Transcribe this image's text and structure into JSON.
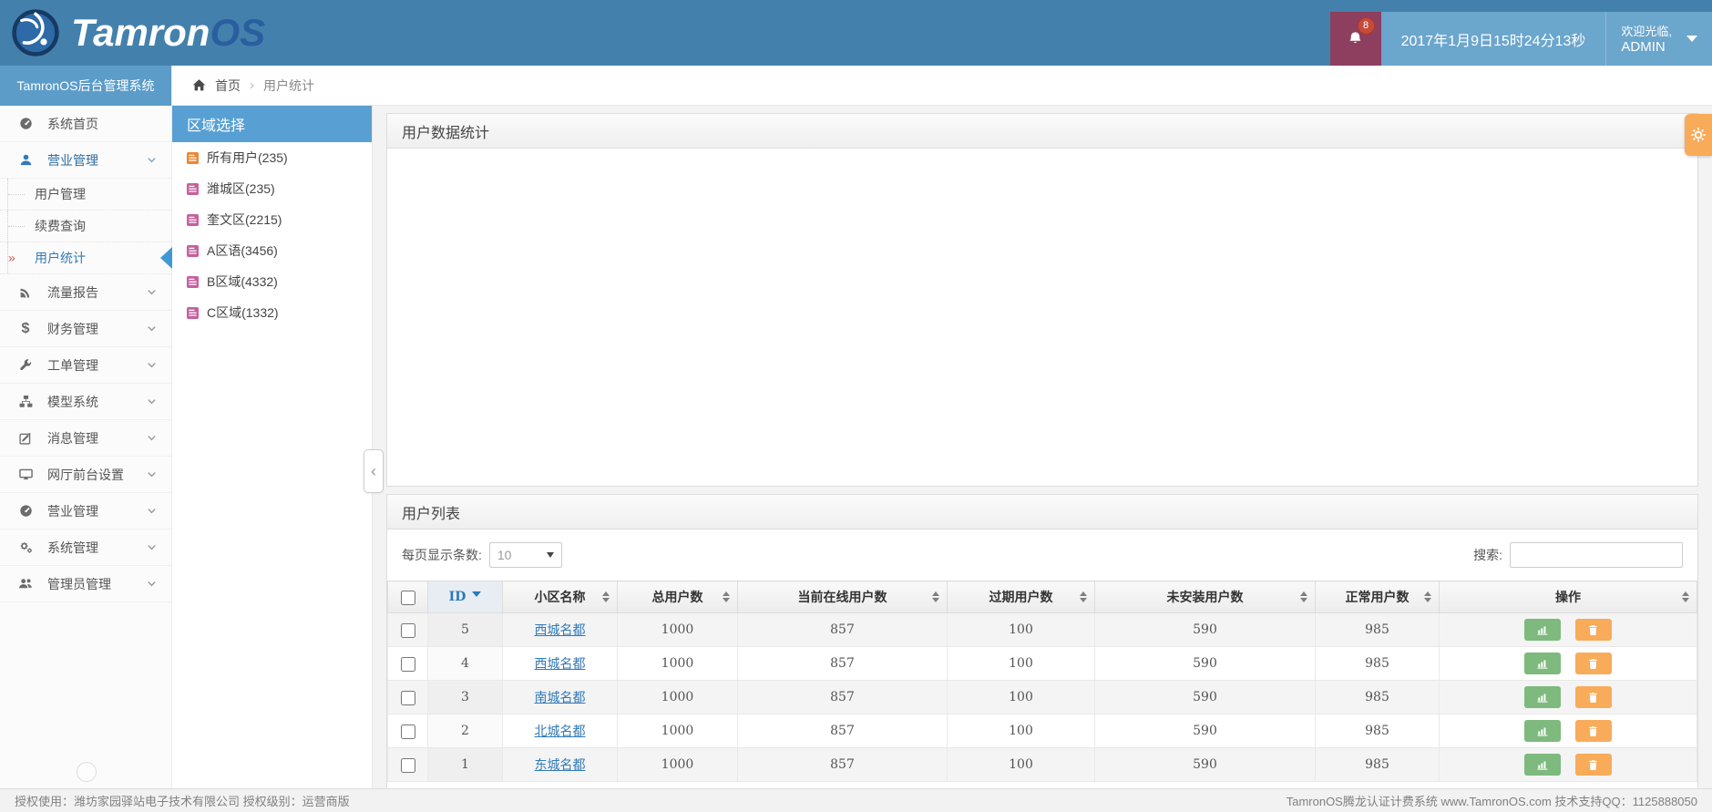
{
  "header": {
    "brand": "Tamron",
    "brand_accent": "OS",
    "badge_count": "8",
    "datetime": "2017年1月9日15时24分13秒",
    "welcome": "欢迎光临,",
    "username": "ADMIN"
  },
  "nav": {
    "title": "TamronOS后台管理系统",
    "items": [
      "系统首页",
      "营业管理",
      "流量报告",
      "财务管理",
      "工单管理",
      "模型系统",
      "消息管理",
      "网厅前台设置",
      "营业管理",
      "系统管理",
      "管理员管理"
    ],
    "sub_items": [
      "用户管理",
      "续费查询",
      "用户统计"
    ]
  },
  "breadcrumb": {
    "home": "首页",
    "separator": "›",
    "current": "用户统计"
  },
  "region": {
    "title": "区域选择",
    "items": [
      "所有用户(235)",
      "潍城区(235)",
      "奎文区(2215)",
      "A区语(3456)",
      "B区域(4332)",
      "C区域(1332)"
    ]
  },
  "stats_panel": {
    "title": "用户数据统计"
  },
  "list_panel": {
    "title": "用户列表",
    "per_page_label": "每页显示条数:",
    "per_page_value": "10",
    "search_label": "搜索:",
    "columns": [
      "ID",
      "小区名称",
      "总用户数",
      "当前在线用户数",
      "过期用户数",
      "未安装用户数",
      "正常用户数",
      "操作"
    ],
    "rows": [
      {
        "id": "5",
        "name": "西城名都",
        "total": "1000",
        "online": "857",
        "expired": "100",
        "uninstalled": "590",
        "normal": "985"
      },
      {
        "id": "4",
        "name": "西城名都",
        "total": "1000",
        "online": "857",
        "expired": "100",
        "uninstalled": "590",
        "normal": "985"
      },
      {
        "id": "3",
        "name": "南城名都",
        "total": "1000",
        "online": "857",
        "expired": "100",
        "uninstalled": "590",
        "normal": "985"
      },
      {
        "id": "2",
        "name": "北城名都",
        "total": "1000",
        "online": "857",
        "expired": "100",
        "uninstalled": "590",
        "normal": "985"
      },
      {
        "id": "1",
        "name": "东城名都",
        "total": "1000",
        "online": "857",
        "expired": "100",
        "uninstalled": "590",
        "normal": "985"
      }
    ]
  },
  "footer": {
    "left": "授权使用：潍坊家园驿站电子技术有限公司  授权级别：运营商版",
    "right": "TamronOS腾龙认证计费系统 www.TamronOS.com 技术支持QQ：1125888050"
  },
  "colors": {
    "accent": "#337ab7",
    "header": "#4381ac",
    "success": "#7eb97e",
    "warning": "#f8ab59"
  }
}
